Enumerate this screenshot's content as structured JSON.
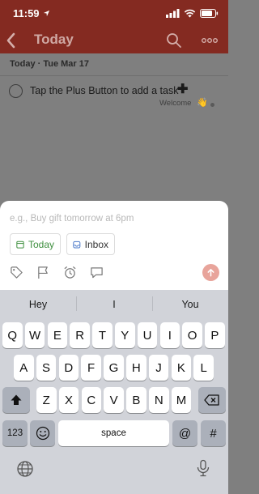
{
  "status": {
    "time": "11:59"
  },
  "nav": {
    "title": "Today"
  },
  "section": {
    "date_header": "Today · Tue Mar 17"
  },
  "task": {
    "text": "Tap the Plus Button to add a task",
    "plus_glyph": "✚",
    "project": "Welcome",
    "project_emoji": "👋"
  },
  "quick_add": {
    "placeholder": "e.g., Buy gift tomorrow at 6pm",
    "chip_today": "Today",
    "chip_inbox": "Inbox"
  },
  "keyboard": {
    "suggestions": [
      "Hey",
      "I",
      "You"
    ],
    "row1": [
      "Q",
      "W",
      "E",
      "R",
      "T",
      "Y",
      "U",
      "I",
      "O",
      "P"
    ],
    "row2": [
      "A",
      "S",
      "D",
      "F",
      "G",
      "H",
      "J",
      "K",
      "L"
    ],
    "row3": [
      "Z",
      "X",
      "C",
      "V",
      "B",
      "N",
      "M"
    ],
    "num_label": "123",
    "space_label": "space",
    "at_label": "@",
    "hash_label": "#"
  },
  "colors": {
    "header": "#842a21",
    "today_green": "#3e8f3e",
    "send_button": "#e8a49b"
  }
}
